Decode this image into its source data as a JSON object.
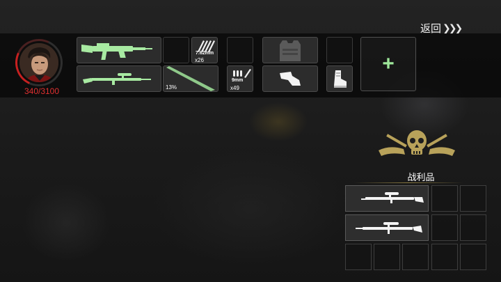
{
  "header": {
    "back_label": "返回",
    "back_chevrons": "❯❯❯"
  },
  "player": {
    "hp_text": "340/3100",
    "hp_fraction": 0.11
  },
  "equipment": {
    "primary_weapon": "assault-rifle",
    "primary_ammo": {
      "caliber": "7.62mm",
      "count": "x26"
    },
    "secondary_weapon": "sniper-rifle",
    "melee_durability": "13%",
    "secondary_ammo": {
      "caliber": "9mm",
      "count": "x49"
    },
    "armor": "vest-icon",
    "helmet": "helmet-icon",
    "boots": "boots-icon"
  },
  "add_label": "+",
  "loot": {
    "title": "战利品",
    "emblem_text": "DEAD · BADGE",
    "items": [
      "sniper-rifle",
      "sniper-rifle"
    ]
  },
  "colors": {
    "accent_green": "#9ee79a",
    "hp_red": "#e03030",
    "gold": "#b8a25a"
  }
}
